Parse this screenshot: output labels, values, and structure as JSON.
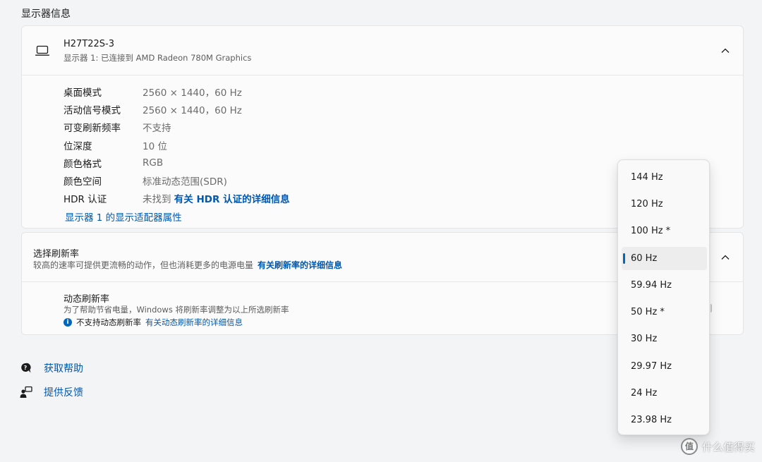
{
  "section_title": "显示器信息",
  "monitor": {
    "name": "H27T22S-3",
    "subtitle": "显示器 1: 已连接到 AMD Radeon 780M Graphics",
    "rows": [
      {
        "label": "桌面模式",
        "value": "2560 × 1440，60 Hz"
      },
      {
        "label": "活动信号模式",
        "value": "2560 × 1440，60 Hz"
      },
      {
        "label": "可变刷新频率",
        "value": "不支持"
      },
      {
        "label": "位深度",
        "value": "10 位"
      },
      {
        "label": "颜色格式",
        "value": "RGB"
      },
      {
        "label": "颜色空间",
        "value": "标准动态范围(SDR)"
      },
      {
        "label": "HDR 认证",
        "value": "未找到",
        "link": "有关 HDR 认证的详细信息"
      }
    ],
    "adapter_link": "显示器 1 的显示适配器属性"
  },
  "refresh": {
    "title": "选择刷新率",
    "description": "较高的速率可提供更流畅的动作，但也消耗更多的电源电量",
    "description_link": "有关刷新率的详细信息",
    "dynamic_title": "动态刷新率",
    "dynamic_description": "为了帮助节省电量，Windows 将刷新率调整为以上所选刷新率",
    "dynamic_note": "不支持动态刷新率",
    "dynamic_note_link": "有关动态刷新率的详细信息"
  },
  "help": {
    "get_help": "获取帮助",
    "feedback": "提供反馈"
  },
  "dropdown": {
    "options": [
      "144 Hz",
      "120 Hz",
      "100 Hz *",
      "60 Hz",
      "59.94 Hz",
      "50 Hz *",
      "30 Hz",
      "29.97 Hz",
      "24 Hz",
      "23.98 Hz"
    ],
    "selected": "60 Hz"
  },
  "watermark": {
    "logo_text": "值",
    "text": "什么值得买"
  },
  "colors": {
    "accent": "#0067c0",
    "link": "#0058b0",
    "background": "#f3f4f6",
    "card": "#fbfbfb"
  },
  "icons": {
    "monitor": "laptop-icon",
    "collapse": "chevron-up-icon",
    "help": "help-chat-icon",
    "feedback": "feedback-person-icon",
    "info": "info-icon"
  }
}
